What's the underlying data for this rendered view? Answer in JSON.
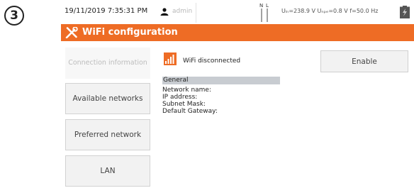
{
  "step": {
    "number": "3"
  },
  "status_bar": {
    "datetime": "19/11/2019 7:35:31 PM",
    "user": "admin",
    "probe_icon": "probe-N-L-icon",
    "probe_label_n": "N",
    "probe_label_l": "L",
    "measurements": "Uₗₙ=238.9 V Uₙₚₑ=0.8 V f=50.0 Hz",
    "battery_icon": "battery-icon"
  },
  "title_bar": {
    "icon": "tools-icon",
    "title": "WiFi configuration",
    "accent_color": "#ee6c25"
  },
  "sidebar": {
    "items": [
      {
        "label": "Connection information",
        "disabled": true
      },
      {
        "label": "Available networks",
        "disabled": false
      },
      {
        "label": "Preferred network",
        "disabled": false
      },
      {
        "label": "LAN",
        "disabled": false
      }
    ]
  },
  "main": {
    "wifi_icon": "wifi-signal-icon",
    "wifi_status": "WiFi disconnected",
    "enable_label": "Enable",
    "general": {
      "header": "General",
      "rows": [
        "Network name:",
        "IP address:",
        "Subnet Mask:",
        "Default Gateway:"
      ]
    }
  }
}
